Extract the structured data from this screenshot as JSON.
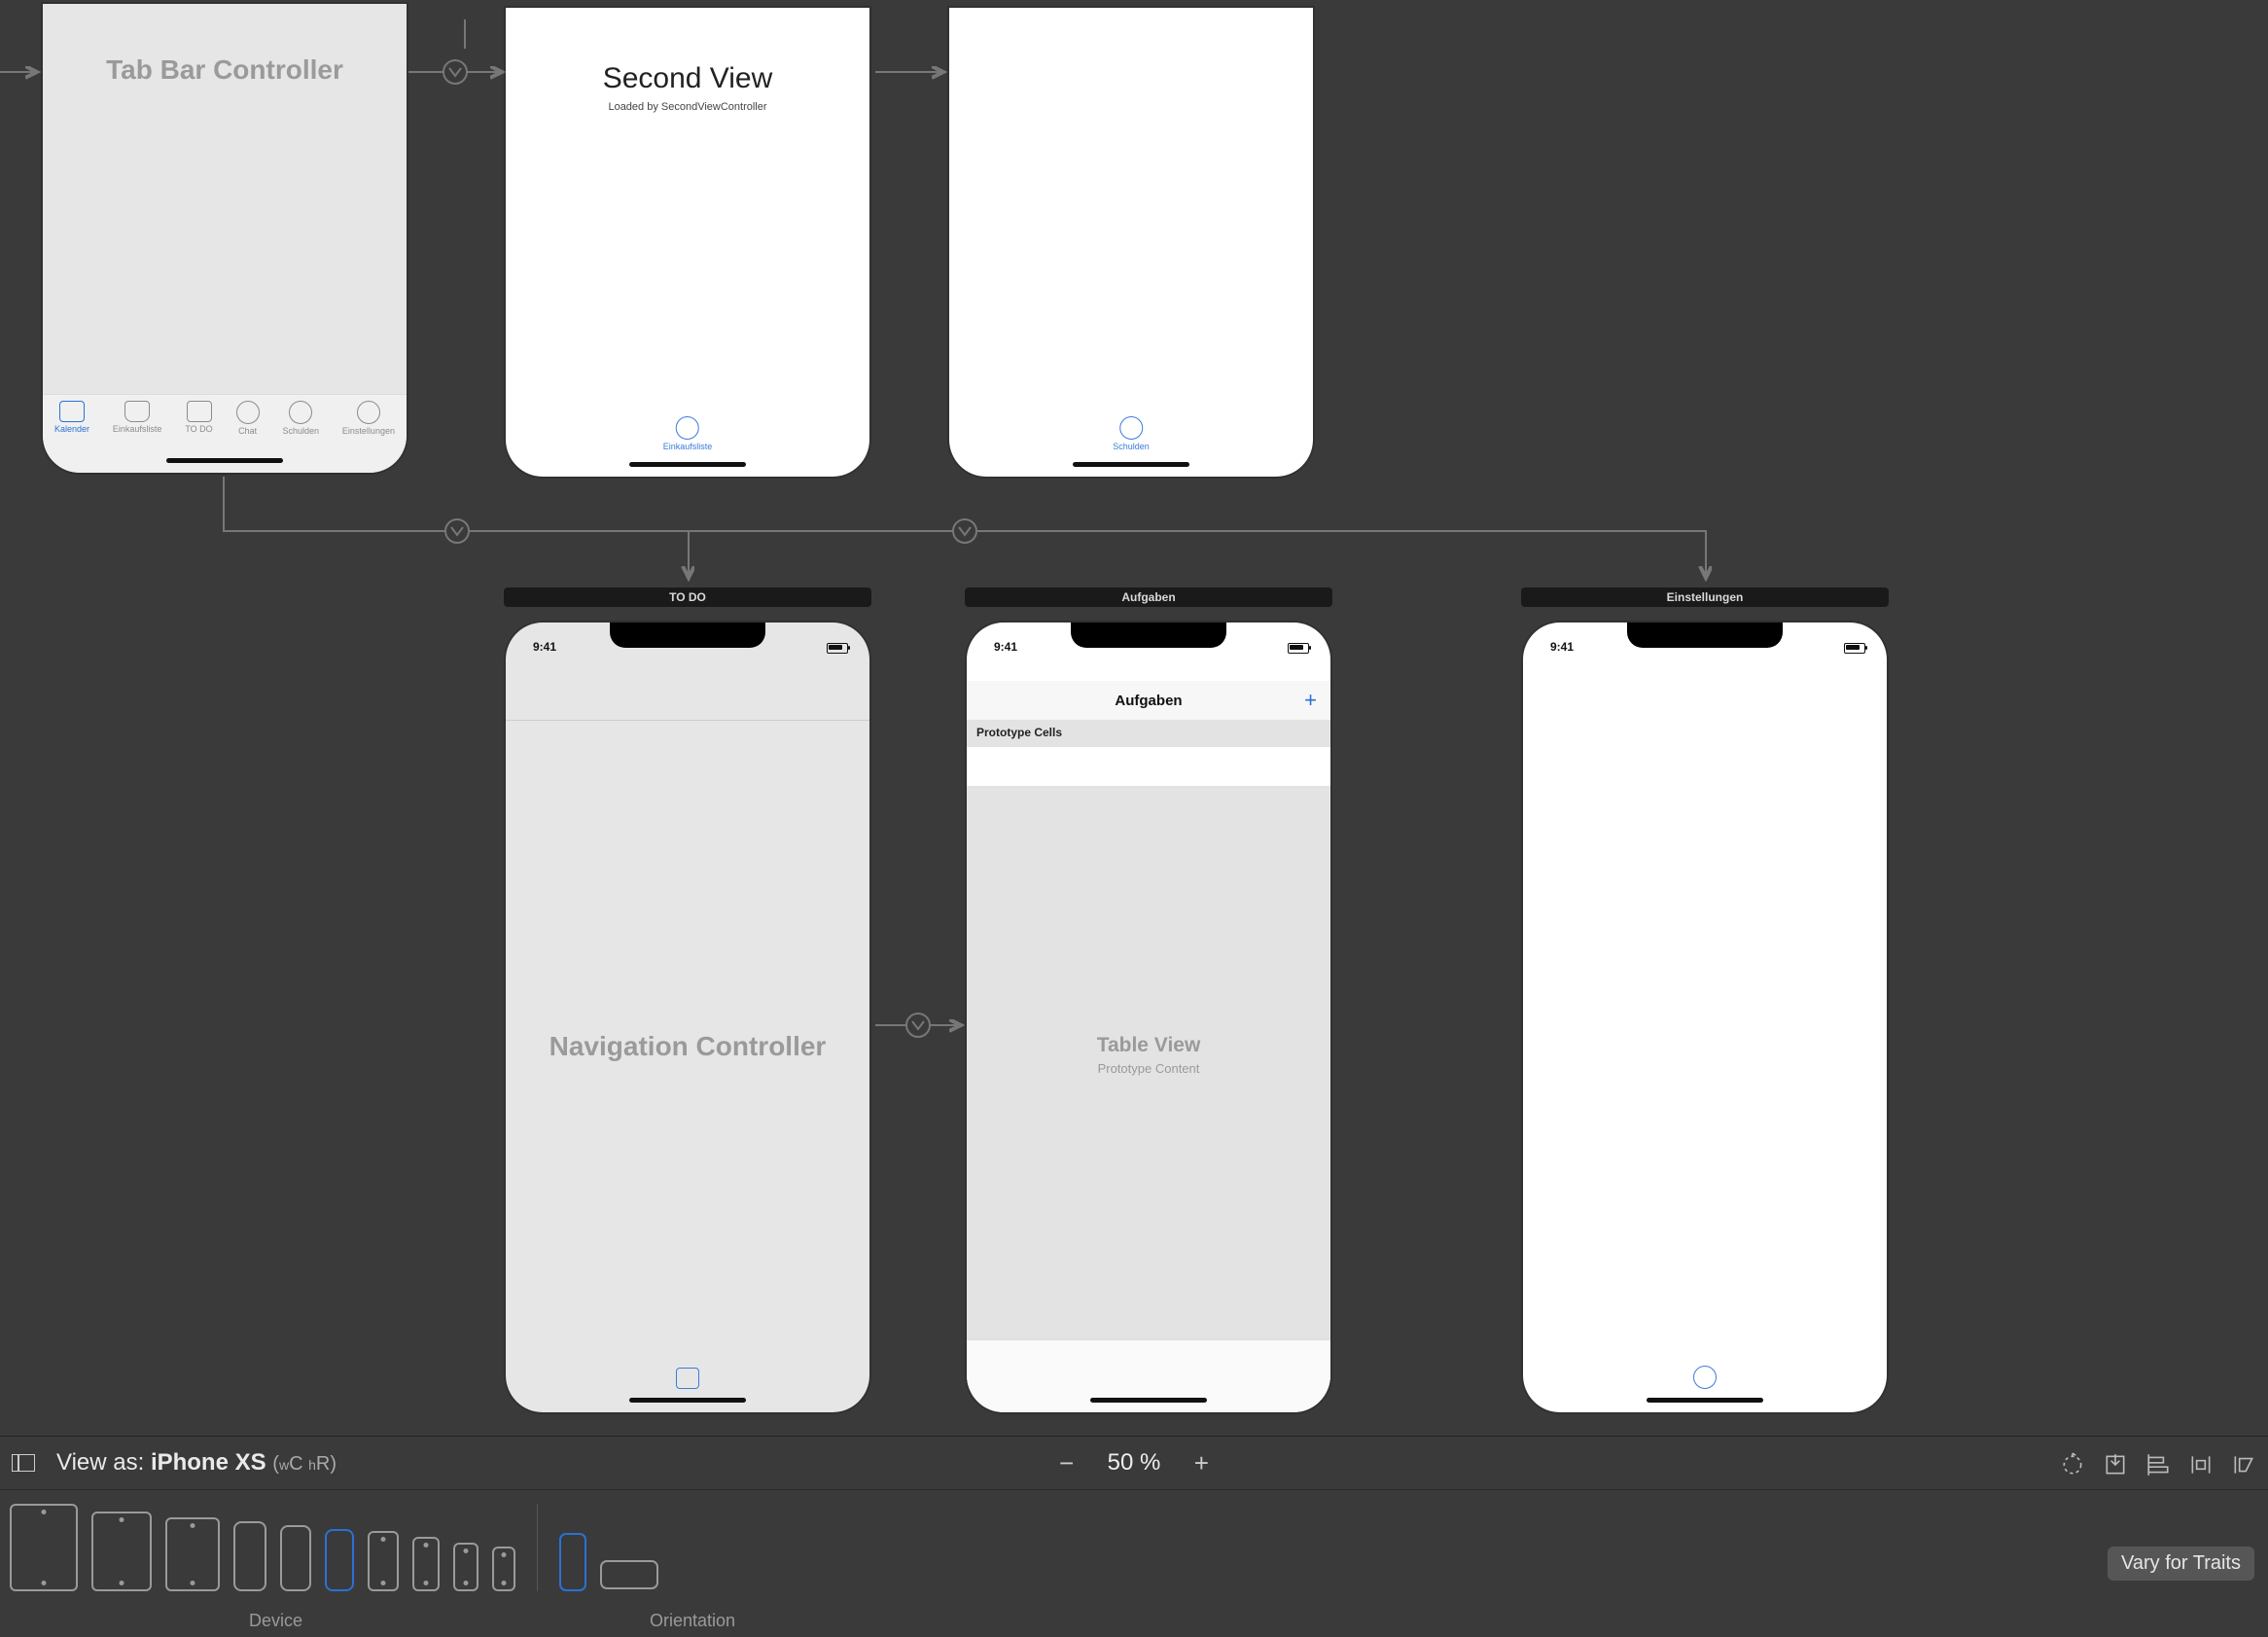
{
  "canvas": {
    "scenes": {
      "tabBarController": {
        "title": "Tab Bar Controller"
      },
      "secondView": {
        "title": "Second View",
        "subtitle": "Loaded by SecondViewController",
        "tab": {
          "label": "Einkaufsliste"
        }
      },
      "blank1": {
        "tab": {
          "label": "Schulden"
        }
      },
      "todoNav": {
        "sceneTitle": "TO DO",
        "time": "9:41",
        "big": "Navigation Controller"
      },
      "aufgaben": {
        "sceneTitle": "Aufgaben",
        "time": "9:41",
        "navTitle": "Aufgaben",
        "protoHeader": "Prototype Cells",
        "tableTitle": "Table View",
        "tableSub": "Prototype Content"
      },
      "einstellungen": {
        "sceneTitle": "Einstellungen",
        "time": "9:41"
      }
    },
    "tabs": [
      {
        "label": "Kalender"
      },
      {
        "label": "Einkaufsliste"
      },
      {
        "label": "TO DO"
      },
      {
        "label": "Chat"
      },
      {
        "label": "Schulden"
      },
      {
        "label": "Einstellungen"
      }
    ]
  },
  "bottom": {
    "viewAsPrefix": "View as: ",
    "viewAsDevice": "iPhone XS",
    "traitW": "w",
    "traitC": "C ",
    "traitH": "h",
    "traitR": "R",
    "zoom": "50 %",
    "deviceLabel": "Device",
    "orientationLabel": "Orientation",
    "varyForTraits": "Vary for Traits"
  }
}
